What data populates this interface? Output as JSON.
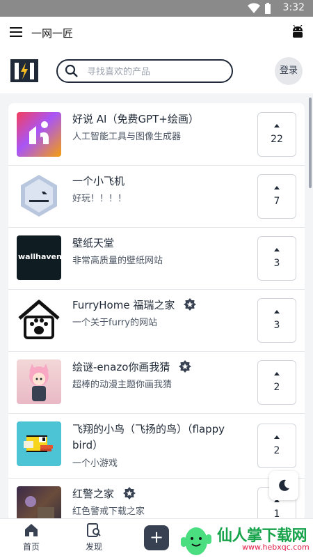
{
  "status_bar": {
    "time": "3:32"
  },
  "app_bar": {
    "title": "一网一匠"
  },
  "header": {
    "search_placeholder": "寻找喜欢的产品",
    "login_label": "登录"
  },
  "products": [
    {
      "title": "好说 AI（免费GPT+绘画）",
      "description": "人工智能工具与图像生成器",
      "votes": "22",
      "featured": false
    },
    {
      "title": "一个小飞机",
      "description": "好玩！！！！",
      "votes": "7",
      "featured": false
    },
    {
      "title": "壁纸天堂",
      "description": "非常高质量的壁纸网站",
      "votes": "3",
      "featured": false,
      "thumb_text": "wallhaven"
    },
    {
      "title": "FurryHome 福瑞之家",
      "description": "一个关于furry的网站",
      "votes": "3",
      "featured": true
    },
    {
      "title": "绘谜-enazo你画我猜",
      "description": "超棒的动漫主题你画我猜",
      "votes": "2",
      "featured": true
    },
    {
      "title": "飞翔的小鸟（飞扬的鸟）（flappy bird）",
      "description": "一个小游戏",
      "votes": "2",
      "featured": false
    },
    {
      "title": "红警之家",
      "description": "红色警戒下载之家",
      "votes": "1",
      "featured": true
    }
  ],
  "tab_bar": {
    "home_label": "首页",
    "discover_label": "发现",
    "add_label": "+"
  },
  "watermark": {
    "text": "仙人掌下载网",
    "url": "www.hebxqc.com"
  },
  "colors": {
    "accent": "#1f2937",
    "background": "#f3f4f6",
    "watermark_green": "#16a34a"
  }
}
